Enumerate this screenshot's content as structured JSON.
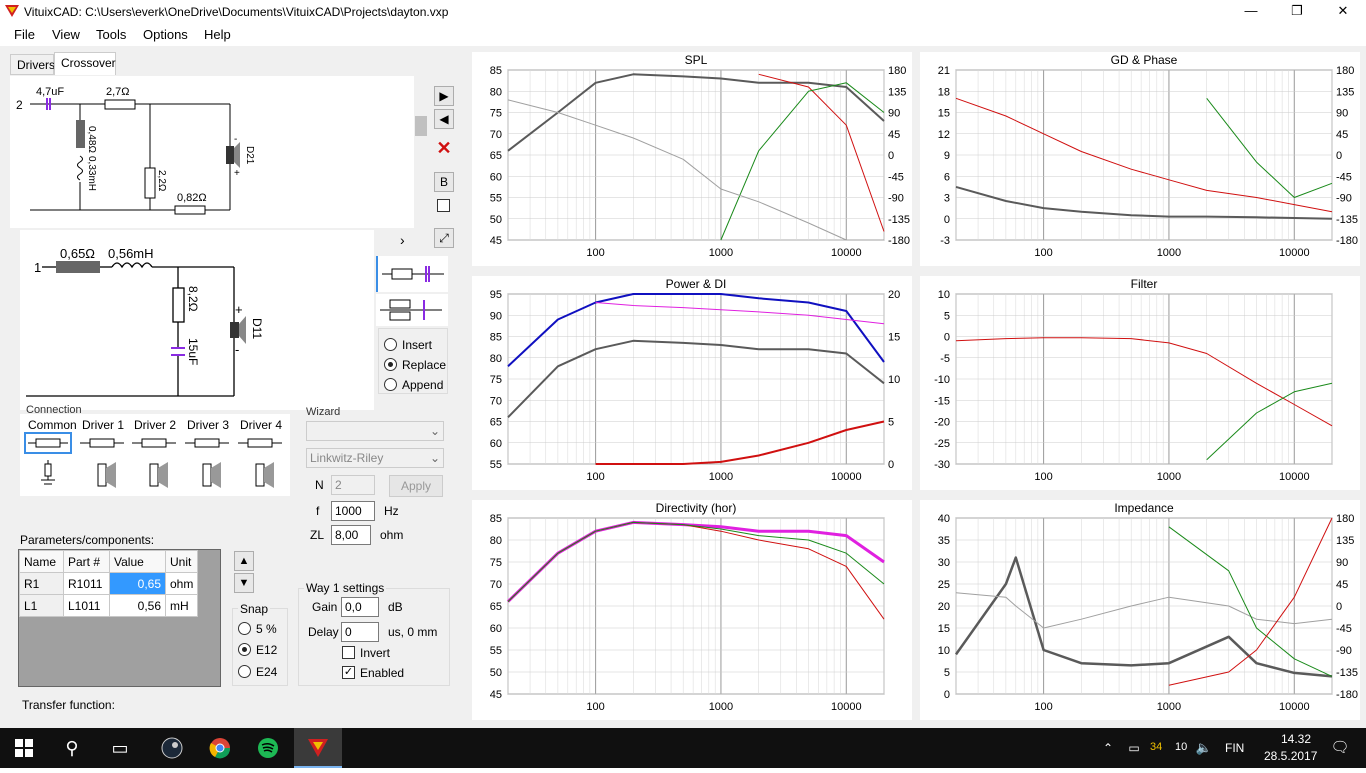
{
  "window": {
    "title": "VituixCAD: C:\\Users\\everk\\OneDrive\\Documents\\VituixCAD\\Projects\\dayton.vxp",
    "min": "—",
    "max": "❐",
    "close": "✕"
  },
  "menu": [
    "File",
    "View",
    "Tools",
    "Options",
    "Help"
  ],
  "tabs": {
    "drivers": "Drivers",
    "crossover": "Crossover"
  },
  "schematic_top": {
    "node": "2",
    "c1": "4,7uF",
    "r1": "2,7Ω",
    "r2": "0,48Ω",
    "l1": "0,33mH",
    "r3": "2,2Ω",
    "d": "D21",
    "r4": "0,82Ω",
    "plus": "+",
    "minus": "-"
  },
  "schematic_main": {
    "node": "1",
    "r1": "0,65Ω",
    "l1": "0,56mH",
    "r2": "8,2Ω",
    "c1": "15uF",
    "d": "D11",
    "plus": "+",
    "minus": "-"
  },
  "side": {
    "up": "▶",
    "down": "◀",
    "delete": "✕",
    "b": "B",
    "expand": "⤢",
    "chev": "›"
  },
  "mode": {
    "insert": "Insert",
    "replace": "Replace",
    "append": "Append"
  },
  "connection": {
    "label": "Connection",
    "cols": [
      "Common",
      "Driver 1",
      "Driver 2",
      "Driver 3",
      "Driver 4"
    ]
  },
  "wizard": {
    "label": "Wizard",
    "type_value": "",
    "filter_value": "Linkwitz-Riley",
    "n_label": "N",
    "n_value": "2",
    "apply": "Apply",
    "f_label": "f",
    "f_value": "1000",
    "f_unit": "Hz",
    "zl_label": "ZL",
    "zl_value": "8,00",
    "zl_unit": "ohm"
  },
  "params": {
    "label": "Parameters/components:",
    "headers": [
      "Name",
      "Part #",
      "Value",
      "Unit"
    ],
    "rows": [
      [
        "R1",
        "R1011",
        "0,65",
        "ohm"
      ],
      [
        "L1",
        "L1011",
        "0,56",
        "mH"
      ]
    ]
  },
  "snap": {
    "label": "Snap",
    "options": [
      "5 %",
      "E12",
      "E24"
    ],
    "up": "▲",
    "down": "▼"
  },
  "way": {
    "label": "Way 1 settings",
    "gain_label": "Gain",
    "gain_value": "0,0",
    "gain_unit": "dB",
    "delay_label": "Delay",
    "delay_value": "0",
    "delay_unit": "us, 0 mm",
    "invert": "Invert",
    "enabled": "Enabled"
  },
  "transfer": "Transfer function:",
  "taskbar": {
    "badge": "34",
    "vol": "10",
    "lang": "FIN",
    "time": "14.32",
    "date": "28.5.2017"
  },
  "colors": {
    "gray": "#5a5a5a",
    "red": "#d01010",
    "green": "#1a8a1a",
    "blue": "#1010c0",
    "magenta": "#e020e0",
    "lightgray": "#a0a0a0"
  },
  "chart_data": [
    {
      "type": "line",
      "title": "SPL",
      "x": [
        20,
        50,
        100,
        200,
        500,
        1000,
        2000,
        5000,
        10000,
        20000
      ],
      "ylim": [
        45,
        85
      ],
      "y2lim": [
        -180,
        180
      ],
      "series": [
        {
          "values": [
            66,
            75,
            82,
            84,
            83.5,
            83,
            82,
            82,
            81,
            73
          ]
        },
        {
          "values": [
            null,
            null,
            null,
            null,
            null,
            null,
            84,
            81,
            72,
            47
          ]
        },
        {
          "values": [
            null,
            null,
            null,
            null,
            null,
            45,
            66,
            80,
            82,
            75
          ]
        },
        {
          "values": [
            78,
            75,
            72,
            69,
            64,
            57,
            54,
            49,
            45,
            45
          ]
        }
      ]
    },
    {
      "type": "line",
      "title": "GD & Phase",
      "x": [
        20,
        50,
        100,
        200,
        500,
        1000,
        2000,
        5000,
        10000,
        20000
      ],
      "ylim": [
        -3,
        21
      ],
      "y2lim": [
        -180,
        180
      ],
      "series": [
        {
          "values": [
            4.5,
            2.5,
            1.5,
            1,
            0.5,
            0.3,
            0.3,
            0.2,
            0.1,
            0
          ]
        },
        {
          "values": [
            17,
            14.5,
            12,
            9.5,
            7,
            5.5,
            4,
            3,
            2,
            1
          ]
        },
        {
          "values": [
            null,
            null,
            null,
            null,
            null,
            null,
            17,
            8,
            3,
            5
          ]
        }
      ]
    },
    {
      "type": "line",
      "title": "Power & DI",
      "x": [
        20,
        50,
        100,
        200,
        500,
        1000,
        2000,
        5000,
        10000,
        20000
      ],
      "ylim": [
        55,
        95
      ],
      "y2lim": [
        0,
        20
      ],
      "series": [
        {
          "values": [
            78,
            89,
            93,
            95,
            95,
            95,
            94,
            93,
            91,
            79
          ]
        },
        {
          "values": [
            66,
            78,
            82,
            84,
            83.5,
            83,
            82,
            82,
            81,
            74
          ]
        },
        {
          "values": [
            null,
            null,
            55,
            55,
            55,
            55.5,
            57,
            60,
            63,
            65
          ]
        },
        {
          "values": [
            null,
            null,
            93,
            92.3,
            91.8,
            91.3,
            90.8,
            90,
            89,
            88
          ]
        }
      ]
    },
    {
      "type": "line",
      "title": "Filter",
      "x": [
        20,
        50,
        100,
        200,
        500,
        1000,
        2000,
        5000,
        10000,
        20000
      ],
      "ylim": [
        -30,
        10
      ],
      "series": [
        {
          "values": [
            -1,
            -0.5,
            -0.3,
            -0.3,
            -0.5,
            -1.5,
            -4,
            -11,
            -16,
            -21
          ]
        },
        {
          "values": [
            null,
            null,
            null,
            null,
            null,
            null,
            -29,
            -18,
            -13,
            -11
          ]
        }
      ]
    },
    {
      "type": "line",
      "title": "Directivity (hor)",
      "x": [
        20,
        50,
        100,
        200,
        500,
        1000,
        2000,
        5000,
        10000,
        20000
      ],
      "ylim": [
        45,
        85
      ],
      "series": [
        {
          "values": [
            66,
            77,
            82,
            84,
            83.5,
            83,
            82,
            82,
            81,
            75
          ]
        },
        {
          "values": [
            66,
            77,
            82,
            84,
            83.5,
            82,
            80,
            78,
            74,
            62
          ]
        },
        {
          "values": [
            66,
            77,
            82,
            84,
            83.5,
            82.5,
            81,
            80,
            77,
            70
          ]
        }
      ]
    },
    {
      "type": "line",
      "title": "Impedance",
      "x": [
        20,
        50,
        60,
        100,
        200,
        500,
        1000,
        3000,
        5000,
        10000,
        20000
      ],
      "ylim": [
        0,
        40
      ],
      "y2lim": [
        -180,
        180
      ],
      "series": [
        {
          "values": [
            9,
            25,
            31,
            10,
            7,
            6.5,
            7,
            13,
            7,
            4.8,
            4
          ]
        },
        {
          "values": [
            23,
            22,
            20,
            15,
            17,
            20,
            22,
            20,
            17,
            16,
            17
          ]
        },
        {
          "values": [
            null,
            null,
            null,
            null,
            null,
            null,
            38,
            28,
            15,
            8,
            4
          ]
        },
        {
          "values": [
            null,
            null,
            null,
            null,
            null,
            null,
            2,
            5,
            10,
            22,
            40
          ]
        }
      ]
    }
  ]
}
